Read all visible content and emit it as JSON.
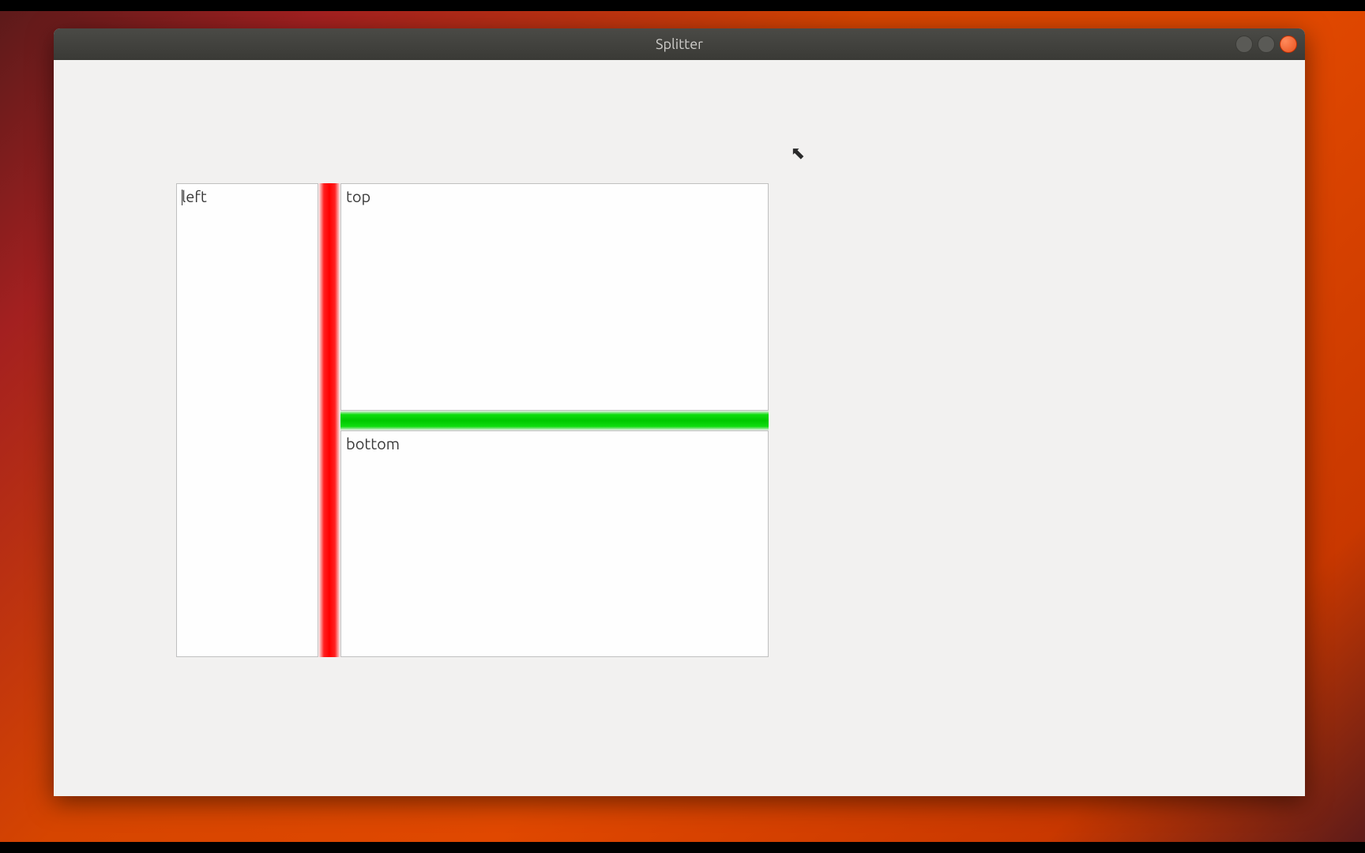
{
  "window": {
    "title": "Splitter"
  },
  "panes": {
    "left_label": "left",
    "top_label": "top",
    "bottom_label": "bottom"
  },
  "splitter_colors": {
    "vertical": "#ff0000",
    "horizontal": "#00c800"
  }
}
